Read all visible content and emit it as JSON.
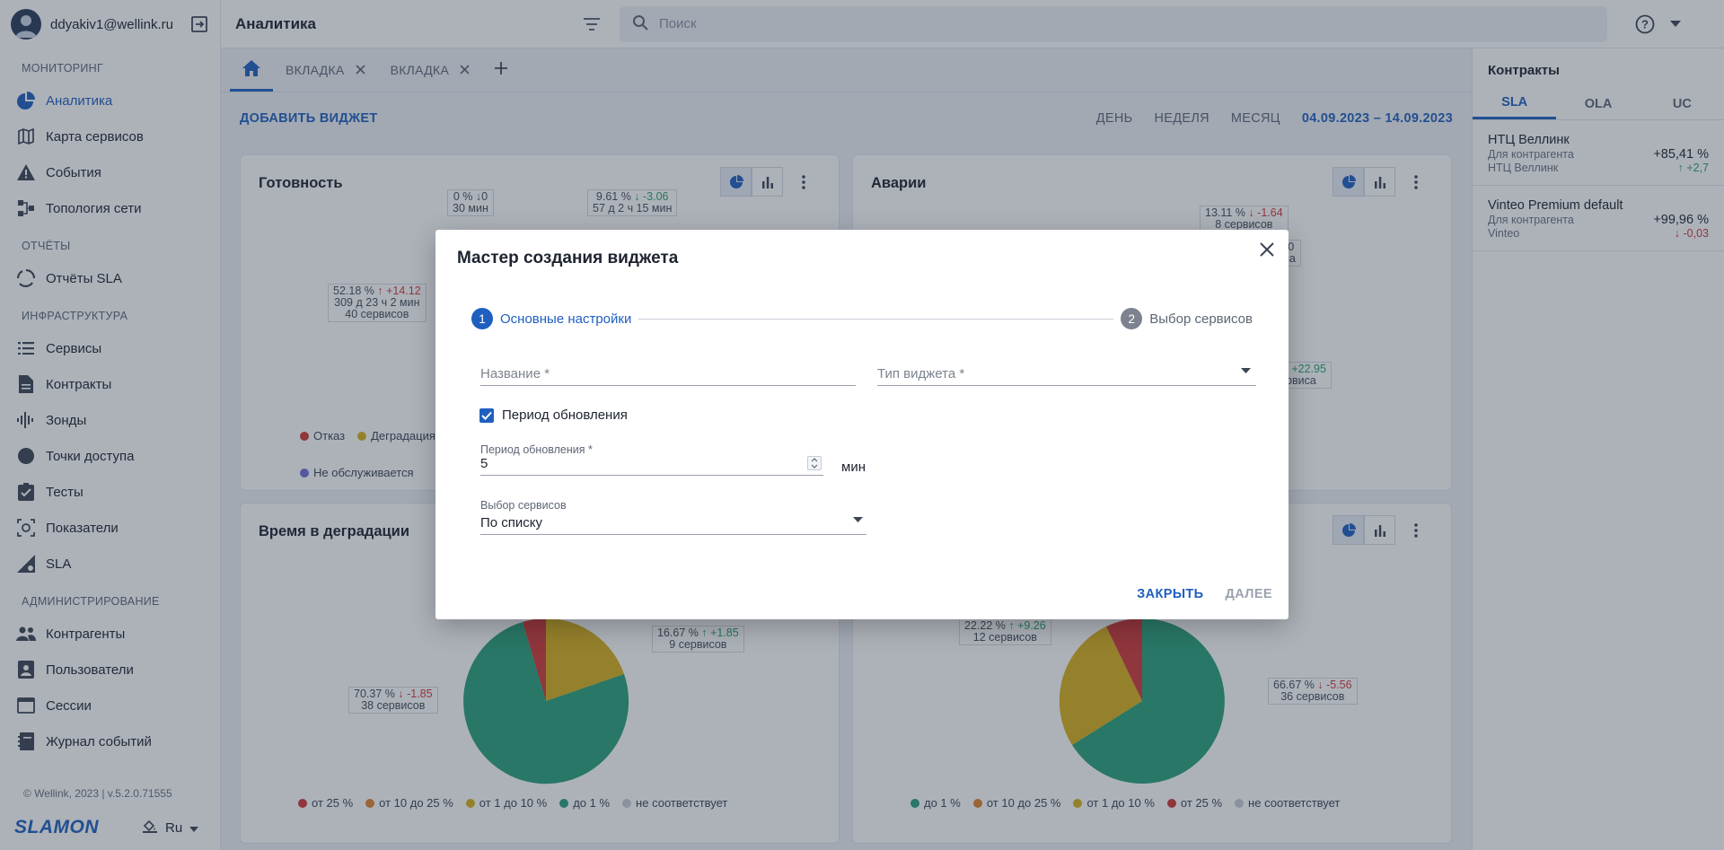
{
  "user": {
    "email": "ddyakiv1@wellink.ru"
  },
  "sidebar": {
    "sections": [
      {
        "title": "МОНИТОРИНГ",
        "items": [
          {
            "label": "Аналитика",
            "icon": "analytics-pie-icon",
            "active": true
          },
          {
            "label": "Карта сервисов",
            "icon": "map-icon"
          },
          {
            "label": "События",
            "icon": "warning-icon"
          },
          {
            "label": "Топология сети",
            "icon": "topology-icon"
          }
        ]
      },
      {
        "title": "ОТЧЁТЫ",
        "items": [
          {
            "label": "Отчёты SLA",
            "icon": "report-circle-icon"
          }
        ]
      },
      {
        "title": "ИНФРАСТРУКТУРА",
        "items": [
          {
            "label": "Сервисы",
            "icon": "list-icon"
          },
          {
            "label": "Контракты",
            "icon": "document-icon"
          },
          {
            "label": "Зонды",
            "icon": "probe-icon"
          },
          {
            "label": "Точки доступа",
            "icon": "access-point-icon"
          },
          {
            "label": "Тесты",
            "icon": "checklist-icon"
          },
          {
            "label": "Показатели",
            "icon": "metrics-icon"
          },
          {
            "label": "SLA",
            "icon": "sla-icon"
          }
        ]
      },
      {
        "title": "АДМИНИСТРИРОВАНИЕ",
        "items": [
          {
            "label": "Контрагенты",
            "icon": "people-icon"
          },
          {
            "label": "Пользователи",
            "icon": "user-card-icon"
          },
          {
            "label": "Сессии",
            "icon": "window-icon"
          },
          {
            "label": "Журнал событий",
            "icon": "journal-icon"
          }
        ]
      }
    ],
    "copyright": "© Wellink, 2023 | v.5.2.0.71555",
    "brand": "SLAMON",
    "language": "Ru"
  },
  "header": {
    "title": "Аналитика",
    "search_placeholder": "Поиск"
  },
  "tabs": [
    {
      "label": "ВКЛАДКА"
    },
    {
      "label": "ВКЛАДКА"
    }
  ],
  "toolbar": {
    "add_widget": "ДОБАВИТЬ ВИДЖЕТ",
    "periods": [
      "ДЕНЬ",
      "НЕДЕЛЯ",
      "МЕСЯЦ"
    ],
    "date_range": "04.09.2023 – 14.09.2023"
  },
  "widgets": {
    "readiness": {
      "title": "Готовность",
      "callouts": [
        {
          "pct": "0 %",
          "delta": "↓0",
          "dir": "none",
          "l2": "30 мин",
          "l3": ""
        },
        {
          "pct": "9.61 %",
          "delta": "↓ -3.06",
          "dir": "down",
          "l2": "57 д 2 ч 15 мин",
          "l3": ""
        },
        {
          "pct": "52.18 %",
          "delta": "↑ +14.12",
          "dir": "up",
          "l2": "309 д 23 ч 2 мин",
          "l3": "40 сервисов"
        }
      ],
      "legend": [
        {
          "label": "Отказ",
          "color": "#d13838"
        },
        {
          "label": "Деградация",
          "color": "#d9b01c"
        },
        {
          "label": "Не обслуживается",
          "color": "#6f6fd6"
        }
      ]
    },
    "accidents": {
      "title": "Аварии",
      "callouts": [
        {
          "pct": "13.11 %",
          "delta": "↓ -1.64",
          "dir": "up",
          "l2": "8 сервисов"
        },
        {
          "pct": "5",
          "delta": "↓0",
          "dir": "none",
          "l2": "виса"
        },
        {
          "pct": "%",
          "delta": "↑ +22.95",
          "dir": "down",
          "l2": "ервиса"
        }
      ]
    },
    "degradation": {
      "title": "Время в деградации",
      "callouts": [
        {
          "pct": "16.67 %",
          "delta": "↑ +1.85",
          "dir": "down",
          "l2": "9 сервисов"
        },
        {
          "pct": "70.37 %",
          "delta": "↓ -1.85",
          "dir": "up",
          "l2": "38 сервисов"
        }
      ],
      "legend": [
        {
          "label": "от 25 %",
          "color": "#d13838"
        },
        {
          "label": "от 10 до 25 %",
          "color": "#e0842a"
        },
        {
          "label": "от 1 до 10 %",
          "color": "#d9b01c"
        },
        {
          "label": "до 1 %",
          "color": "#2aa07a"
        },
        {
          "label": "не соответствует",
          "color": "#c8ccd2"
        }
      ]
    },
    "fourth": {
      "callouts": [
        {
          "pct": "22.22 %",
          "delta": "↑ +9.26",
          "dir": "down",
          "l2": "12 сервисов"
        },
        {
          "pct": "66.67 %",
          "delta": "↓ -5.56",
          "dir": "up",
          "l2": "36 сервисов"
        }
      ],
      "legend": [
        {
          "label": "до 1 %",
          "color": "#2aa07a"
        },
        {
          "label": "от 10 до 25 %",
          "color": "#e0842a"
        },
        {
          "label": "от 1 до 10 %",
          "color": "#d9b01c"
        },
        {
          "label": "от 25 %",
          "color": "#d13838"
        },
        {
          "label": "не соответствует",
          "color": "#c8ccd2"
        }
      ]
    }
  },
  "contracts_panel": {
    "title": "Контракты",
    "tabs": [
      "SLA",
      "OLA",
      "UC"
    ],
    "items": [
      {
        "name": "НТЦ Веллинк",
        "sub1": "Для контрагента",
        "sub2": "НТЦ Веллинк",
        "value": "+85,41 %",
        "delta": "↑ +2,7",
        "dir": "down"
      },
      {
        "name": "Vinteo Premium default",
        "sub1": "Для контрагента",
        "sub2": "Vinteo",
        "value": "+99,96 %",
        "delta": "↓ -0,03",
        "dir": "up"
      }
    ]
  },
  "modal": {
    "title": "Мастер создания виджета",
    "steps": [
      {
        "num": "1",
        "label": "Основные настройки"
      },
      {
        "num": "2",
        "label": "Выбор сервисов"
      }
    ],
    "name_placeholder": "Название *",
    "type_placeholder": "Тип виджета *",
    "checkbox_label": "Период обновления",
    "period_label": "Период обновления *",
    "period_value": "5",
    "period_unit": "мин",
    "services_label": "Выбор сервисов",
    "services_value": "По списку",
    "close_button": "ЗАКРЫТЬ",
    "next_button": "ДАЛЕЕ"
  },
  "colors": {
    "accent": "#1f5fbf",
    "fail": "#d13838",
    "degradation": "#d9b01c",
    "ok": "#2aa07a"
  }
}
